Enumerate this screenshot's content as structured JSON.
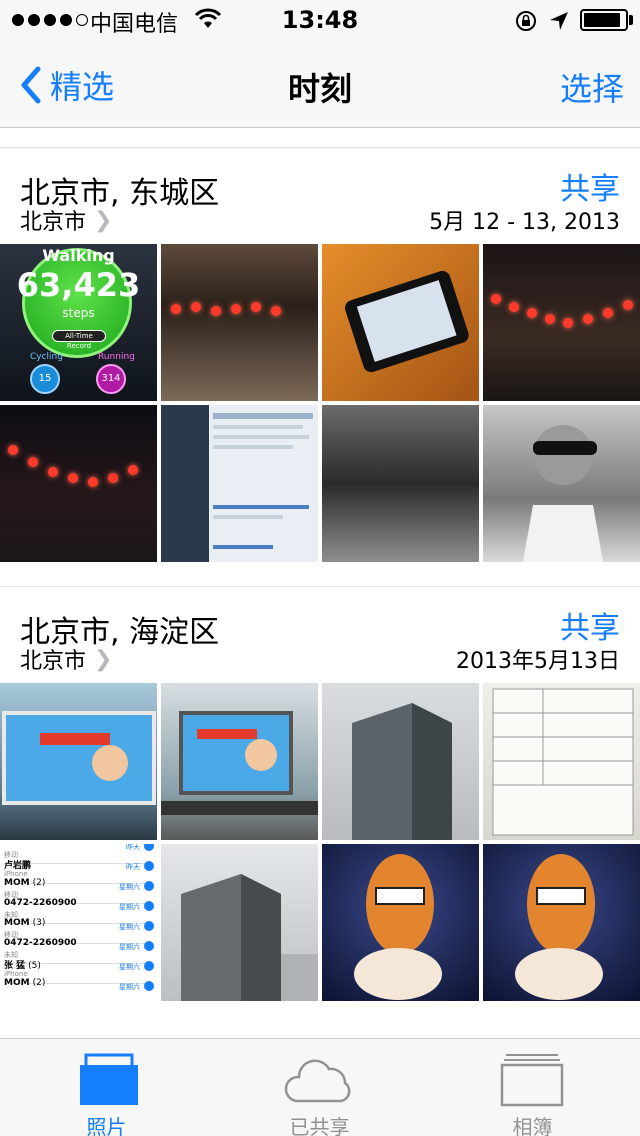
{
  "status_bar": {
    "carrier": "中国电信",
    "time": "13:48",
    "battery_level": 0.9
  },
  "nav": {
    "back_label": "精选",
    "title": "时刻",
    "right_label": "选择"
  },
  "sections": [
    {
      "title": "北京市, 东城区",
      "share_label": "共享",
      "subtitle": "北京市",
      "date": "5月 12 - 13, 2013",
      "walking": {
        "label": "Walking",
        "value": "63,423",
        "unit": "steps",
        "badge": "All-Time Record",
        "cycling_label": "Cycling",
        "cycling_value": "15",
        "running_label": "Running",
        "running_value": "314"
      }
    },
    {
      "title": "北京市, 海淀区",
      "share_label": "共享",
      "subtitle": "北京市",
      "date": "2013年5月13日",
      "contacts": [
        {
          "name": "",
          "sub": "移动",
          "day": "昨天"
        },
        {
          "name": "卢岩鹏",
          "sub": "iPhone",
          "day": "昨天"
        },
        {
          "name": "MOM",
          "count": "(2)",
          "sub": "移动",
          "day": "星期六"
        },
        {
          "name": "0472-2260900",
          "sub": "未知",
          "day": "星期六"
        },
        {
          "name": "MOM",
          "count": "(3)",
          "sub": "移动",
          "day": "星期六"
        },
        {
          "name": "0472-2260900",
          "sub": "未知",
          "day": "星期六"
        },
        {
          "name": "张 猛",
          "count": "(5)",
          "sub": "iPhone",
          "day": "星期六"
        },
        {
          "name": "MOM",
          "count": "(2)",
          "sub": "",
          "day": "星期六"
        }
      ]
    }
  ],
  "tab_bar": {
    "tabs": [
      {
        "label": "照片",
        "icon": "photos-icon",
        "active": true
      },
      {
        "label": "已共享",
        "icon": "cloud-icon",
        "active": false
      },
      {
        "label": "相簿",
        "icon": "albums-icon",
        "active": false
      }
    ]
  },
  "colors": {
    "accent": "#157efb",
    "bar_background": "#f7f7f8",
    "inactive_tab": "#929292"
  }
}
